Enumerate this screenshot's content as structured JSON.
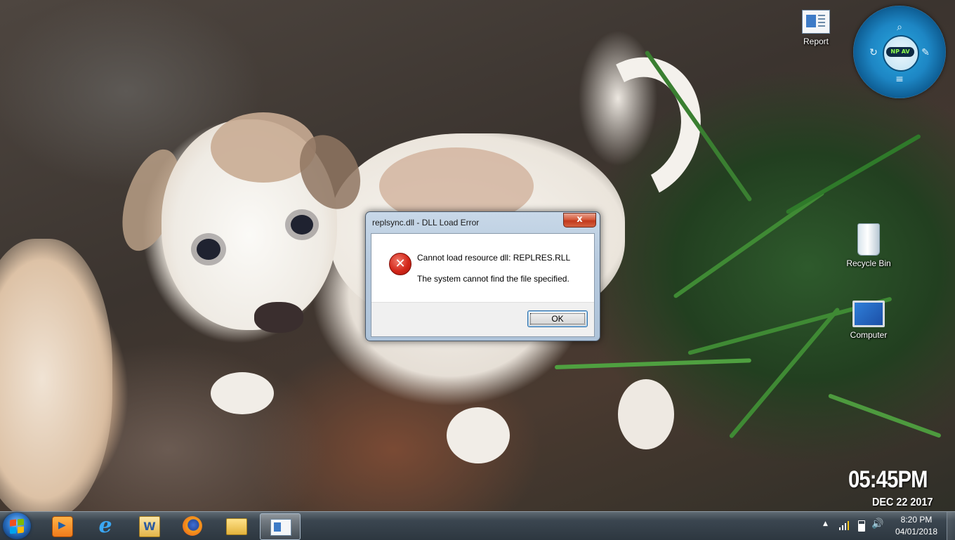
{
  "desktop": {
    "icons": [
      {
        "label": "Report",
        "icon": "report-document-icon"
      },
      {
        "label": "Recycle Bin",
        "icon": "recycle-bin-icon"
      },
      {
        "label": "Computer",
        "icon": "computer-monitor-icon"
      }
    ],
    "gadget": {
      "badge": "NP AV",
      "icons": [
        "search-icon",
        "refresh-icon",
        "wrench-icon",
        "list-icon"
      ]
    },
    "clock": {
      "time": "05:45PM",
      "date": "DEC 22 2017"
    }
  },
  "dialog": {
    "title": "replsync.dll - DLL Load Error",
    "close_label": "x",
    "icon": "error-x-icon",
    "message_line1": "Cannot load resource dll: REPLRES.RLL",
    "message_line2": "The system cannot find the file specified.",
    "ok_label": "OK",
    "accent_color": "#d3271a"
  },
  "taskbar": {
    "start": "windows-start-icon",
    "pinned": [
      {
        "name": "Windows Media Player",
        "icon": "media-player-icon"
      },
      {
        "name": "Internet Explorer",
        "icon": "internet-explorer-icon",
        "glyph": "e"
      },
      {
        "name": "Microsoft Word",
        "icon": "word-icon",
        "glyph": "W"
      },
      {
        "name": "Firefox",
        "icon": "firefox-icon"
      },
      {
        "name": "Windows Explorer",
        "icon": "folder-icon"
      },
      {
        "name": "Report",
        "icon": "report-document-icon"
      }
    ],
    "tray": {
      "chevron": "▲",
      "time": "8:20 PM",
      "date": "04/01/2018",
      "volume_glyph": "🔊"
    }
  }
}
